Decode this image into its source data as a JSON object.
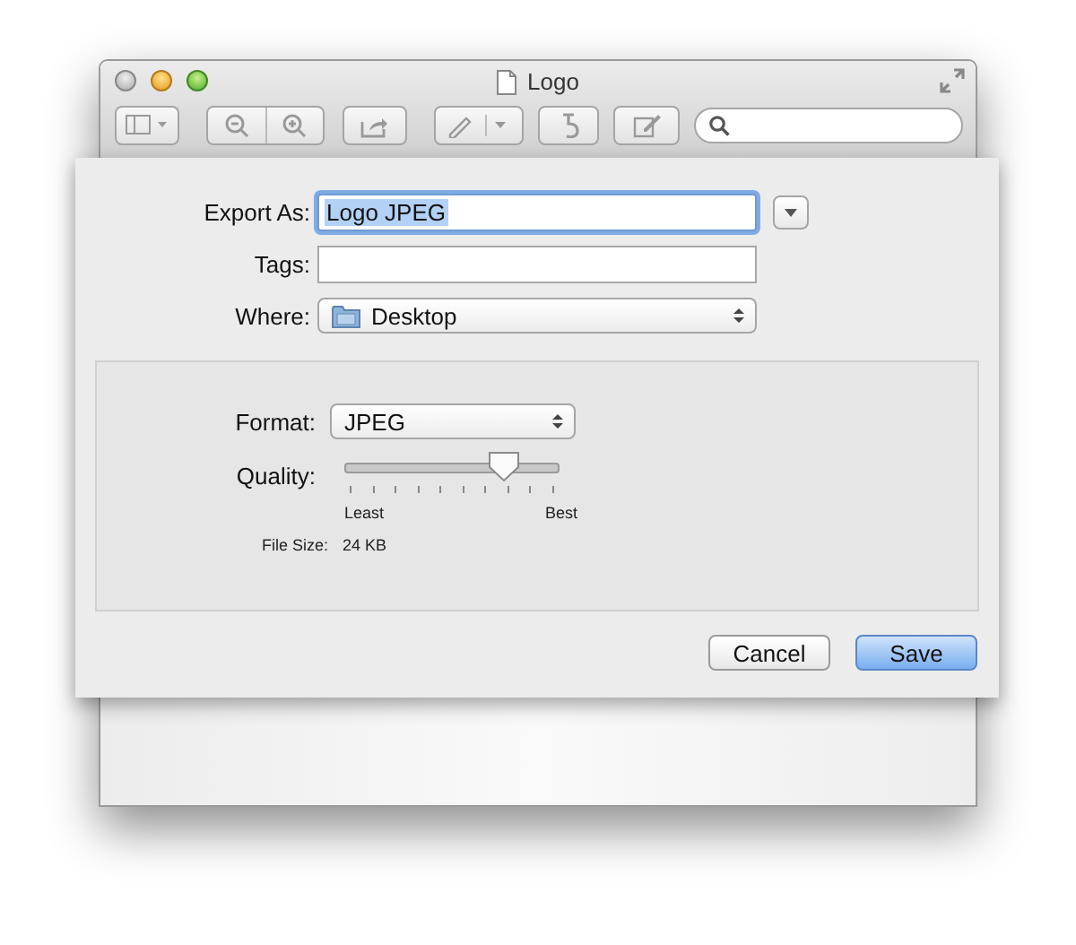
{
  "window": {
    "title": "Logo"
  },
  "export_sheet": {
    "export_as": {
      "label": "Export As:",
      "value": "Logo JPEG",
      "text_selected": true
    },
    "tags": {
      "label": "Tags:"
    },
    "where": {
      "label": "Where:",
      "value": "Desktop"
    },
    "options": {
      "format": {
        "label": "Format:",
        "value": "JPEG"
      },
      "quality": {
        "label": "Quality:",
        "level": 0.74,
        "min_label": "Least",
        "max_label": "Best"
      },
      "file_size": {
        "label": "File Size:",
        "value": "24 KB"
      }
    },
    "buttons": [
      {
        "label": "Cancel",
        "default": false
      },
      {
        "label": "Save",
        "default": true
      }
    ]
  }
}
